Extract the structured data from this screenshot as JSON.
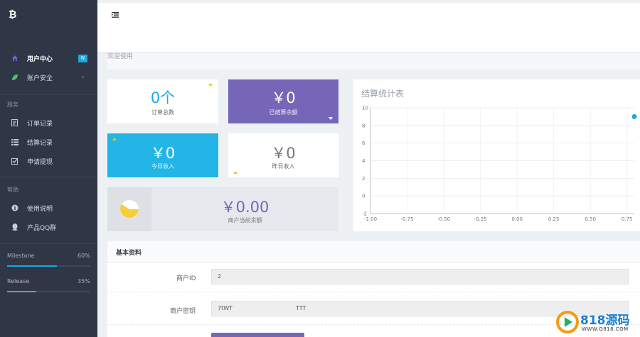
{
  "sidebar": {
    "logo_icon": "bitcoin-icon",
    "items": [
      {
        "label": "用户中心",
        "icon": "home-icon",
        "badge": "N",
        "active": true
      },
      {
        "label": "账户安全",
        "icon": "leaf-icon",
        "chevron": "›"
      }
    ],
    "section_service": "服务",
    "service_items": [
      {
        "label": "订单记录",
        "icon": "document-icon"
      },
      {
        "label": "结算记录",
        "icon": "list-icon"
      },
      {
        "label": "申请提现",
        "icon": "checkbox-icon"
      }
    ],
    "section_help": "帮助",
    "help_items": [
      {
        "label": "使用说明",
        "icon": "info-icon"
      },
      {
        "label": "产品QQ群",
        "icon": "qq-icon"
      }
    ],
    "progress": [
      {
        "label": "Milestone",
        "value": "60%",
        "fraction": 0.6
      },
      {
        "label": "Release",
        "value": "35%",
        "fraction": 0.35
      }
    ]
  },
  "header": {
    "menu_icon": "menu-icon"
  },
  "breadcrumb": {
    "text": "欢迎使用"
  },
  "stats": {
    "orders": {
      "value": "0个",
      "label": "订单总数"
    },
    "settled": {
      "value": "￥0",
      "label": "已结算余额"
    },
    "today": {
      "value": "￥0",
      "label": "今日收入"
    },
    "yesterday": {
      "value": "￥0",
      "label": "昨日收入"
    },
    "balance": {
      "value": "￥0.00",
      "label": "商户当前余额"
    }
  },
  "chart_data": {
    "type": "scatter",
    "title": "结算统计表",
    "x_ticks": [
      "-1.00",
      "-0.75",
      "-0.50",
      "-0.25",
      "0.00",
      "0.25",
      "0.50",
      "0.75"
    ],
    "y_ticks": [
      "10",
      "8",
      "6",
      "4",
      "2",
      "0",
      "-2"
    ],
    "xlim": [
      -1.0,
      0.8
    ],
    "ylim": [
      -2,
      10
    ],
    "grid": true,
    "points": [
      {
        "x": 0.8,
        "y": 9
      }
    ]
  },
  "basic_info": {
    "title": "基本资料",
    "merchant_id_label": "商户ID",
    "merchant_id_value": "2",
    "merchant_key_label": "商户密钥",
    "merchant_key_value": "7tWT                                   TTT"
  },
  "colors": {
    "sidebar_bg": "#2f3646",
    "purple": "#7566b8",
    "blue": "#22b5e6",
    "accent_text": "#1ba8e0"
  },
  "watermark": {
    "brand": "818源码",
    "url": "WWW.Q818.COM"
  }
}
